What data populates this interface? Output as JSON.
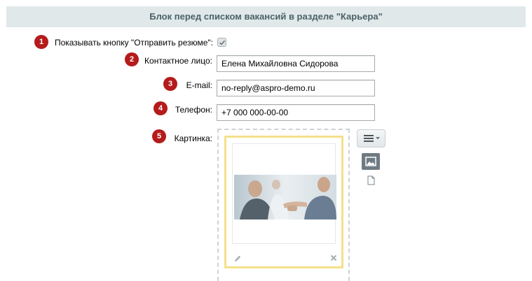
{
  "section": {
    "title": "Блок перед списком вакансий в разделе \"Карьера\""
  },
  "fields": {
    "show_button": {
      "badge": "1",
      "label": "Показывать кнопку \"Отправить резюме\":",
      "checked": true
    },
    "contact": {
      "badge": "2",
      "label": "Контактное лицо:",
      "value": "Елена Михайловна Сидорова"
    },
    "email": {
      "badge": "3",
      "label": "E-mail:",
      "value": "no-reply@aspro-demo.ru"
    },
    "phone": {
      "badge": "4",
      "label": "Телефон:",
      "value": "+7 000 000-00-00"
    },
    "picture": {
      "badge": "5",
      "label": "Картинка:"
    }
  },
  "icons": {
    "menu": "menu-lines-icon",
    "image": "image-icon",
    "file": "file-icon",
    "edit": "pencil-icon",
    "delete": "close-icon"
  },
  "colors": {
    "badge": "#b51b1b",
    "header_bg": "#e0e8ea",
    "header_text": "#4b6267",
    "image_frame": "#f5e08a"
  }
}
